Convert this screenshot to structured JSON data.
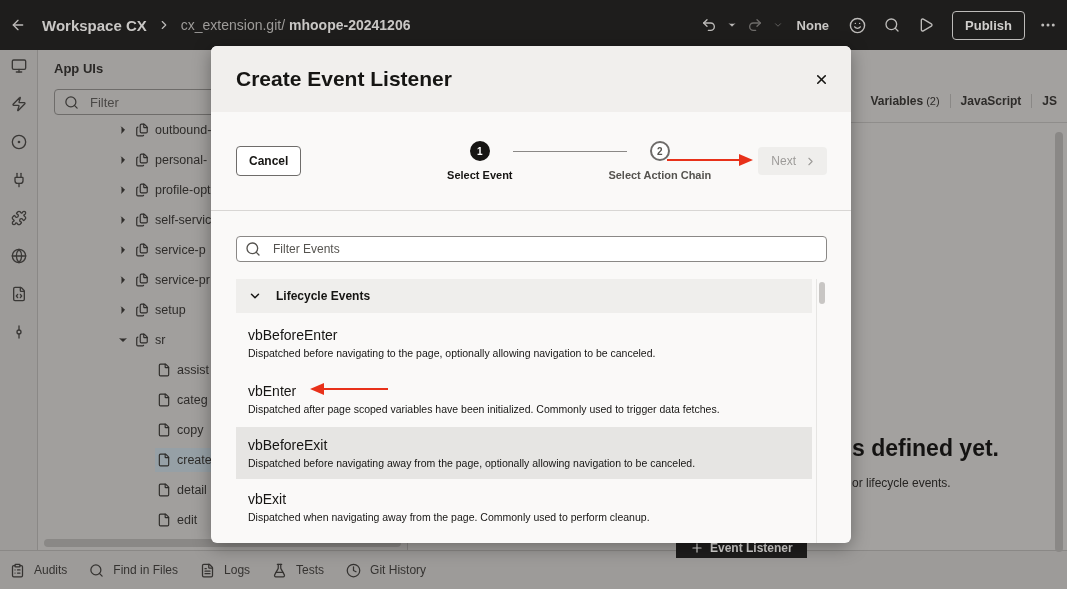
{
  "top_bar": {
    "title": "Workspace CX",
    "path_prefix": "cx_extension.git/",
    "branch": "mhoope-20241206",
    "mode": "None",
    "publish": "Publish"
  },
  "explorer": {
    "title": "App UIs",
    "filter_placeholder": "Filter",
    "tree": [
      {
        "label": "outbound-",
        "expanded": false
      },
      {
        "label": "personal-",
        "expanded": false
      },
      {
        "label": "profile-opt",
        "expanded": false
      },
      {
        "label": "self-servic",
        "expanded": false
      },
      {
        "label": "service-p",
        "expanded": false
      },
      {
        "label": "service-pr",
        "expanded": false
      },
      {
        "label": "setup",
        "expanded": false
      },
      {
        "label": "sr",
        "expanded": true,
        "children": [
          {
            "label": "assist",
            "selected": false
          },
          {
            "label": "categ",
            "selected": false
          },
          {
            "label": "copy",
            "selected": false
          },
          {
            "label": "create",
            "selected": true
          },
          {
            "label": "detail",
            "selected": false
          },
          {
            "label": "edit",
            "selected": false
          }
        ]
      }
    ]
  },
  "editor": {
    "tabs": [
      {
        "label": "Variables",
        "count": "(2)"
      },
      {
        "label": "JavaScript"
      },
      {
        "label": "JS"
      }
    ],
    "empty_state": {
      "heading": "s defined yet.",
      "text": "or lifecycle events.",
      "button": "Event Listener"
    }
  },
  "bottom_bar": [
    {
      "label": "Audits",
      "kind": "audits"
    },
    {
      "label": "Find in Files",
      "kind": "search"
    },
    {
      "label": "Logs",
      "kind": "logs"
    },
    {
      "label": "Tests",
      "kind": "tests"
    },
    {
      "label": "Git History",
      "kind": "history"
    }
  ],
  "dialog": {
    "title": "Create Event Listener",
    "cancel": "Cancel",
    "steps": [
      {
        "number": "1",
        "label": "Select Event",
        "selected": true
      },
      {
        "number": "2",
        "label": "Select Action Chain",
        "selected": false
      }
    ],
    "next": {
      "label": "Next",
      "disabled": true
    },
    "filter_placeholder": "Filter Events",
    "groups": [
      {
        "label": "Lifecycle Events",
        "expanded": true,
        "events": [
          {
            "name": "vbBeforeEnter",
            "description": "Dispatched before navigating to the page, optionally allowing navigation to be canceled.",
            "selected": false
          },
          {
            "name": "vbEnter",
            "description": "Dispatched after page scoped variables have been initialized. Commonly used to trigger data fetches.",
            "selected": false
          },
          {
            "name": "vbBeforeExit",
            "description": "Dispatched before navigating away from the page, optionally allowing navigation to be canceled.",
            "selected": true
          },
          {
            "name": "vbExit",
            "description": "Dispatched when navigating away from the page. Commonly used to perform cleanup.",
            "selected": false
          }
        ]
      }
    ]
  }
}
